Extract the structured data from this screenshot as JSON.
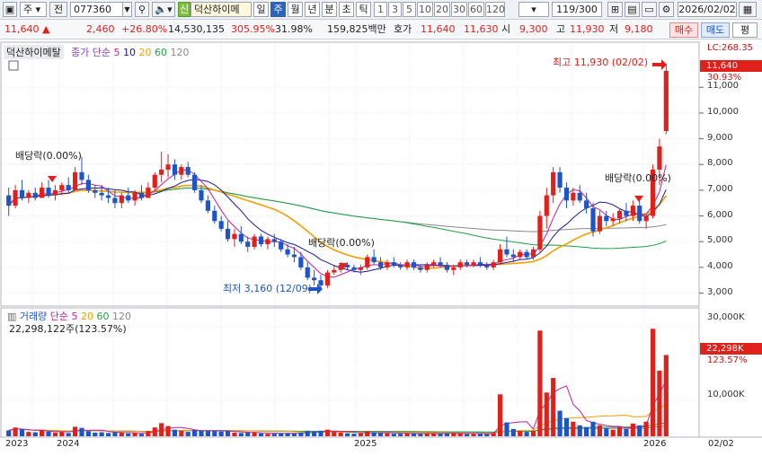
{
  "toolbar": {
    "market_select": "주",
    "prev_label": "전",
    "code": "077360",
    "badge": "신",
    "stock_name": "덕산하이메",
    "periods": [
      "일",
      "주",
      "월",
      "년",
      "분",
      "초",
      "틱"
    ],
    "active_period": "주",
    "intervals": [
      "1",
      "3",
      "5",
      "10",
      "20",
      "30",
      "60",
      "120"
    ],
    "count": "119/300",
    "date": "2026/02/02"
  },
  "quote": {
    "price": "11,640",
    "change": "2,460",
    "change_pct": "+26.80%",
    "volume": "14,530,135",
    "vol_ratio": "305.95%",
    "turnover": "31.98%",
    "amount": "159,825백만",
    "hoga_label": "호가",
    "ask": "11,640",
    "bid": "11,630",
    "open_label": "시",
    "open": "9,300",
    "high_label": "고",
    "high": "11,930",
    "low_label": "저",
    "low": "9,180",
    "buy_label": "매수",
    "sell_label": "매도",
    "eval_label": "평"
  },
  "legend": {
    "name": "덕산하이메탈",
    "ma_label": "종가 단순",
    "periods": [
      "5",
      "10",
      "20",
      "60",
      "120"
    ],
    "vol_label": "거래량",
    "vol_ma_label": "단순",
    "vol_info": "22,298,122주(123.57%)"
  },
  "annotations": {
    "high": "최고 11,930 (02/02)",
    "low": "최저 3,160 (12/09)",
    "div1": "배당락(0.00%)",
    "div2": "배당락(0.00%)",
    "div3": "배당락(0.00%)"
  },
  "price_axis": {
    "ticks": [
      "11,000",
      "10,000",
      "9,000",
      "8,000",
      "7,000",
      "6,000",
      "5,000",
      "4,000",
      "3,000"
    ],
    "lc_label": "LC:268.35",
    "current_tag": "11,640",
    "pct_tag": "30.93%"
  },
  "volume_axis": {
    "ticks": [
      "30,000K",
      "10,000K"
    ],
    "current_tag": "22,298K",
    "pct_tag": "123.57%"
  },
  "time_axis": [
    "2023",
    "2024",
    "2025",
    "2026",
    "02/02"
  ],
  "colors": {
    "up": "#e0201b",
    "down": "#1d54c7",
    "ma5": "#c0209f",
    "ma10": "#1a1a9a",
    "ma20": "#f0a000",
    "ma60": "#20a040",
    "ma120": "#888888"
  },
  "chart_data": {
    "type": "candlestick",
    "price_ylim": [
      2600,
      12300
    ],
    "volume_ylim": [
      0,
      34000000
    ],
    "candles": [
      {
        "o": 6800,
        "h": 7100,
        "l": 6000,
        "c": 6400,
        "v": 1600000
      },
      {
        "o": 6400,
        "h": 7200,
        "l": 6300,
        "c": 7000,
        "v": 2400000
      },
      {
        "o": 7000,
        "h": 7400,
        "l": 6600,
        "c": 6700,
        "v": 1900000
      },
      {
        "o": 6700,
        "h": 7000,
        "l": 6500,
        "c": 6900,
        "v": 1200000
      },
      {
        "o": 6900,
        "h": 7100,
        "l": 6600,
        "c": 6700,
        "v": 1100000
      },
      {
        "o": 6700,
        "h": 7300,
        "l": 6700,
        "c": 7100,
        "v": 1700000
      },
      {
        "o": 7100,
        "h": 7400,
        "l": 6700,
        "c": 6800,
        "v": 1300000
      },
      {
        "o": 6800,
        "h": 7200,
        "l": 6600,
        "c": 7000,
        "v": 1000000
      },
      {
        "o": 7000,
        "h": 7300,
        "l": 6800,
        "c": 7200,
        "v": 1200000
      },
      {
        "o": 7200,
        "h": 7500,
        "l": 6900,
        "c": 7000,
        "v": 900000
      },
      {
        "o": 7000,
        "h": 7900,
        "l": 7000,
        "c": 7700,
        "v": 2600000
      },
      {
        "o": 7700,
        "h": 8300,
        "l": 7200,
        "c": 7400,
        "v": 2300000
      },
      {
        "o": 7400,
        "h": 7600,
        "l": 6900,
        "c": 7000,
        "v": 1400000
      },
      {
        "o": 7000,
        "h": 7200,
        "l": 6700,
        "c": 6900,
        "v": 1000000
      },
      {
        "o": 6900,
        "h": 7200,
        "l": 6600,
        "c": 6800,
        "v": 1100000
      },
      {
        "o": 6800,
        "h": 7100,
        "l": 6500,
        "c": 6700,
        "v": 900000
      },
      {
        "o": 6700,
        "h": 7000,
        "l": 6300,
        "c": 6500,
        "v": 1200000
      },
      {
        "o": 6500,
        "h": 6900,
        "l": 6300,
        "c": 6800,
        "v": 1000000
      },
      {
        "o": 6800,
        "h": 7100,
        "l": 6500,
        "c": 6600,
        "v": 800000
      },
      {
        "o": 6600,
        "h": 7000,
        "l": 6400,
        "c": 6900,
        "v": 900000
      },
      {
        "o": 6900,
        "h": 7200,
        "l": 6600,
        "c": 6700,
        "v": 700000
      },
      {
        "o": 6700,
        "h": 7300,
        "l": 6700,
        "c": 7100,
        "v": 1400000
      },
      {
        "o": 7100,
        "h": 7700,
        "l": 7000,
        "c": 7600,
        "v": 2400000
      },
      {
        "o": 7600,
        "h": 8500,
        "l": 7300,
        "c": 7800,
        "v": 3600000
      },
      {
        "o": 7800,
        "h": 8400,
        "l": 7500,
        "c": 8000,
        "v": 2800000
      },
      {
        "o": 8000,
        "h": 8200,
        "l": 7400,
        "c": 7600,
        "v": 1800000
      },
      {
        "o": 7600,
        "h": 8000,
        "l": 7400,
        "c": 7900,
        "v": 1500000
      },
      {
        "o": 7900,
        "h": 8100,
        "l": 7500,
        "c": 7600,
        "v": 1200000
      },
      {
        "o": 7600,
        "h": 7700,
        "l": 6900,
        "c": 7000,
        "v": 1700000
      },
      {
        "o": 7000,
        "h": 7200,
        "l": 6500,
        "c": 6600,
        "v": 1600000
      },
      {
        "o": 6600,
        "h": 6800,
        "l": 6100,
        "c": 6200,
        "v": 1500000
      },
      {
        "o": 6200,
        "h": 6400,
        "l": 5700,
        "c": 5800,
        "v": 1400000
      },
      {
        "o": 5800,
        "h": 6000,
        "l": 5400,
        "c": 5500,
        "v": 1300000
      },
      {
        "o": 5500,
        "h": 5800,
        "l": 5000,
        "c": 5100,
        "v": 1400000
      },
      {
        "o": 5100,
        "h": 5500,
        "l": 4800,
        "c": 5300,
        "v": 1000000
      },
      {
        "o": 5300,
        "h": 5600,
        "l": 4900,
        "c": 5000,
        "v": 900000
      },
      {
        "o": 5000,
        "h": 5200,
        "l": 4600,
        "c": 4800,
        "v": 1000000
      },
      {
        "o": 4800,
        "h": 5300,
        "l": 4700,
        "c": 5200,
        "v": 1100000
      },
      {
        "o": 5200,
        "h": 5300,
        "l": 4800,
        "c": 4900,
        "v": 800000
      },
      {
        "o": 4900,
        "h": 5200,
        "l": 4700,
        "c": 5100,
        "v": 700000
      },
      {
        "o": 5100,
        "h": 5300,
        "l": 4800,
        "c": 5000,
        "v": 700000
      },
      {
        "o": 5000,
        "h": 5100,
        "l": 4600,
        "c": 4700,
        "v": 800000
      },
      {
        "o": 4700,
        "h": 4900,
        "l": 4400,
        "c": 4500,
        "v": 900000
      },
      {
        "o": 4500,
        "h": 4800,
        "l": 4200,
        "c": 4400,
        "v": 800000
      },
      {
        "o": 4400,
        "h": 4600,
        "l": 3900,
        "c": 4000,
        "v": 1000000
      },
      {
        "o": 4000,
        "h": 4200,
        "l": 3500,
        "c": 3600,
        "v": 1400000
      },
      {
        "o": 3600,
        "h": 3900,
        "l": 3300,
        "c": 3500,
        "v": 1300000
      },
      {
        "o": 3500,
        "h": 3700,
        "l": 3160,
        "c": 3300,
        "v": 1500000
      },
      {
        "o": 3300,
        "h": 3900,
        "l": 3200,
        "c": 3800,
        "v": 1800000
      },
      {
        "o": 3800,
        "h": 4100,
        "l": 3700,
        "c": 3900,
        "v": 1200000
      },
      {
        "o": 3900,
        "h": 4200,
        "l": 3800,
        "c": 4100,
        "v": 1000000
      },
      {
        "o": 4100,
        "h": 4200,
        "l": 3900,
        "c": 4000,
        "v": 800000
      },
      {
        "o": 4000,
        "h": 4100,
        "l": 3800,
        "c": 3900,
        "v": 700000
      },
      {
        "o": 3900,
        "h": 4100,
        "l": 3700,
        "c": 4000,
        "v": 800000
      },
      {
        "o": 4000,
        "h": 4500,
        "l": 3900,
        "c": 4400,
        "v": 1300000
      },
      {
        "o": 4400,
        "h": 4700,
        "l": 4100,
        "c": 4200,
        "v": 1100000
      },
      {
        "o": 4200,
        "h": 4400,
        "l": 3900,
        "c": 4000,
        "v": 900000
      },
      {
        "o": 4000,
        "h": 4300,
        "l": 3900,
        "c": 4200,
        "v": 800000
      },
      {
        "o": 4200,
        "h": 4400,
        "l": 4000,
        "c": 4100,
        "v": 700000
      },
      {
        "o": 4100,
        "h": 4200,
        "l": 3900,
        "c": 4000,
        "v": 700000
      },
      {
        "o": 4000,
        "h": 4300,
        "l": 3900,
        "c": 4200,
        "v": 800000
      },
      {
        "o": 4200,
        "h": 4300,
        "l": 3900,
        "c": 4000,
        "v": 700000
      },
      {
        "o": 4000,
        "h": 4100,
        "l": 3800,
        "c": 3900,
        "v": 700000
      },
      {
        "o": 3900,
        "h": 4200,
        "l": 3800,
        "c": 4100,
        "v": 800000
      },
      {
        "o": 4100,
        "h": 4300,
        "l": 4000,
        "c": 4200,
        "v": 700000
      },
      {
        "o": 4200,
        "h": 4400,
        "l": 4000,
        "c": 4100,
        "v": 700000
      },
      {
        "o": 4100,
        "h": 4200,
        "l": 3800,
        "c": 3900,
        "v": 800000
      },
      {
        "o": 3900,
        "h": 4100,
        "l": 3700,
        "c": 4000,
        "v": 900000
      },
      {
        "o": 4000,
        "h": 4300,
        "l": 3900,
        "c": 4200,
        "v": 800000
      },
      {
        "o": 4200,
        "h": 4300,
        "l": 4000,
        "c": 4100,
        "v": 600000
      },
      {
        "o": 4100,
        "h": 4300,
        "l": 4000,
        "c": 4200,
        "v": 600000
      },
      {
        "o": 4200,
        "h": 4400,
        "l": 4000,
        "c": 4100,
        "v": 700000
      },
      {
        "o": 4100,
        "h": 4200,
        "l": 3900,
        "c": 4000,
        "v": 600000
      },
      {
        "o": 4000,
        "h": 4300,
        "l": 3900,
        "c": 4200,
        "v": 900000
      },
      {
        "o": 4200,
        "h": 4900,
        "l": 4100,
        "c": 4700,
        "v": 11500000
      },
      {
        "o": 4700,
        "h": 5200,
        "l": 4400,
        "c": 4500,
        "v": 3800000
      },
      {
        "o": 4500,
        "h": 4700,
        "l": 4200,
        "c": 4400,
        "v": 2000000
      },
      {
        "o": 4400,
        "h": 4700,
        "l": 4300,
        "c": 4600,
        "v": 1500000
      },
      {
        "o": 4600,
        "h": 4700,
        "l": 4300,
        "c": 4400,
        "v": 1200000
      },
      {
        "o": 4400,
        "h": 4800,
        "l": 4300,
        "c": 4700,
        "v": 1500000
      },
      {
        "o": 4700,
        "h": 6200,
        "l": 4600,
        "c": 6000,
        "v": 29000000
      },
      {
        "o": 6000,
        "h": 7100,
        "l": 5500,
        "c": 6800,
        "v": 12000000
      },
      {
        "o": 6800,
        "h": 7900,
        "l": 6500,
        "c": 7700,
        "v": 16000000
      },
      {
        "o": 7700,
        "h": 7900,
        "l": 6900,
        "c": 7100,
        "v": 7000000
      },
      {
        "o": 7100,
        "h": 7300,
        "l": 6300,
        "c": 6600,
        "v": 5000000
      },
      {
        "o": 6600,
        "h": 7100,
        "l": 6400,
        "c": 6900,
        "v": 4000000
      },
      {
        "o": 6900,
        "h": 7200,
        "l": 6500,
        "c": 6600,
        "v": 3000000
      },
      {
        "o": 6600,
        "h": 6900,
        "l": 6100,
        "c": 6300,
        "v": 2500000
      },
      {
        "o": 6300,
        "h": 6500,
        "l": 5200,
        "c": 5400,
        "v": 4000000
      },
      {
        "o": 5400,
        "h": 6200,
        "l": 5300,
        "c": 6000,
        "v": 3000000
      },
      {
        "o": 6000,
        "h": 6200,
        "l": 5600,
        "c": 5800,
        "v": 2200000
      },
      {
        "o": 5800,
        "h": 6100,
        "l": 5600,
        "c": 5900,
        "v": 1800000
      },
      {
        "o": 5900,
        "h": 6300,
        "l": 5700,
        "c": 6200,
        "v": 2500000
      },
      {
        "o": 6200,
        "h": 6500,
        "l": 5800,
        "c": 6000,
        "v": 2000000
      },
      {
        "o": 6000,
        "h": 6600,
        "l": 5800,
        "c": 6400,
        "v": 3500000
      },
      {
        "o": 6400,
        "h": 6600,
        "l": 5700,
        "c": 5800,
        "v": 3000000
      },
      {
        "o": 5800,
        "h": 6100,
        "l": 5500,
        "c": 6000,
        "v": 4000000
      },
      {
        "o": 6000,
        "h": 8000,
        "l": 5900,
        "c": 7800,
        "v": 29500000
      },
      {
        "o": 7800,
        "h": 9000,
        "l": 7200,
        "c": 8700,
        "v": 18000000
      },
      {
        "o": 9300,
        "h": 11930,
        "l": 9180,
        "c": 11640,
        "v": 22298122
      }
    ]
  }
}
